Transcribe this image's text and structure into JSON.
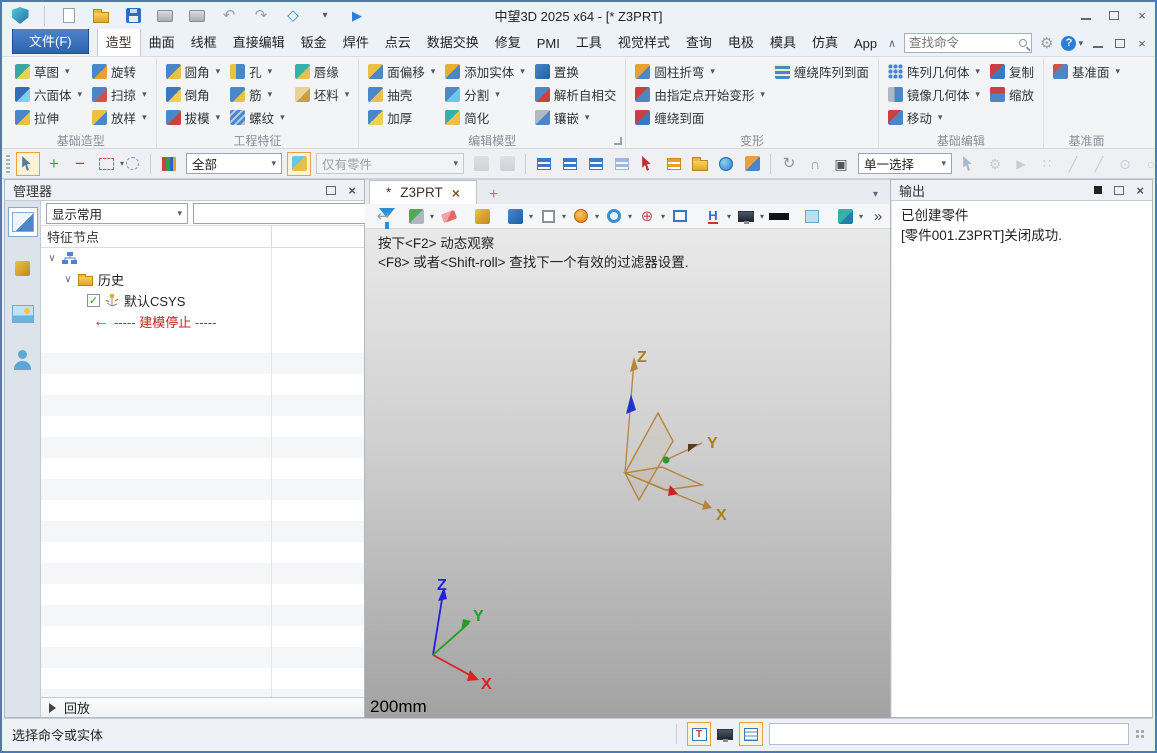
{
  "window": {
    "title": "中望3D 2025 x64 - [*  Z3PRT]"
  },
  "qat": {
    "icons": [
      {
        "icon": "app-logo-icon"
      },
      {
        "sep": true
      },
      {
        "icon": "new-file-icon"
      },
      {
        "icon": "open-file-icon"
      },
      {
        "icon": "save-icon"
      },
      {
        "icon": "print-icon"
      },
      {
        "icon": "plot-icon"
      },
      {
        "icon": "undo-icon"
      },
      {
        "icon": "redo-icon"
      },
      {
        "icon": "regen-icon"
      },
      {
        "icon": "qat-more-icon"
      },
      {
        "icon": "start-icon"
      }
    ]
  },
  "menu": {
    "file_button": "文件(F)",
    "tabs": [
      {
        "label": "造型",
        "active": true
      },
      {
        "label": "曲面"
      },
      {
        "label": "线框"
      },
      {
        "label": "直接编辑"
      },
      {
        "label": "钣金"
      },
      {
        "label": "焊件"
      },
      {
        "label": "点云"
      },
      {
        "label": "数据交换"
      },
      {
        "label": "修复"
      },
      {
        "label": "PMI"
      },
      {
        "label": "工具"
      },
      {
        "label": "视觉样式"
      },
      {
        "label": "查询"
      },
      {
        "label": "电极"
      },
      {
        "label": "模具"
      },
      {
        "label": "仿真"
      },
      {
        "label": "App"
      }
    ],
    "search_placeholder": "查找命令"
  },
  "ribbon": {
    "groups": [
      {
        "label": "基础造型",
        "items": [
          {
            "label": "草图",
            "icon": "sketch-icon",
            "dd": true
          },
          {
            "label": "六面体",
            "icon": "box-icon",
            "dd": true
          },
          {
            "label": "拉伸",
            "icon": "extrude-icon"
          },
          {
            "label": "旋转",
            "icon": "revolve-icon"
          },
          {
            "label": "扫掠",
            "icon": "sweep-icon",
            "dd": true
          },
          {
            "label": "放样",
            "icon": "loft-icon",
            "dd": true
          }
        ]
      },
      {
        "label": "工程特征",
        "items": [
          {
            "label": "圆角",
            "icon": "fillet-icon",
            "dd": true
          },
          {
            "label": "倒角",
            "icon": "chamfer-icon"
          },
          {
            "label": "拔模",
            "icon": "draft-icon",
            "dd": true
          },
          {
            "label": "孔",
            "icon": "hole-icon",
            "dd": true
          },
          {
            "label": "筋",
            "icon": "rib-icon",
            "dd": true
          },
          {
            "label": "螺纹",
            "icon": "thread-icon",
            "dd": true
          },
          {
            "label": "唇缘",
            "icon": "lip-icon"
          },
          {
            "label": "坯料",
            "icon": "stock-icon",
            "dd": true
          }
        ]
      },
      {
        "label": "编辑模型",
        "items": [
          {
            "label": "面偏移",
            "icon": "face-offset-icon",
            "dd": true
          },
          {
            "label": "抽壳",
            "icon": "shell-icon"
          },
          {
            "label": "加厚",
            "icon": "thicken-icon"
          },
          {
            "label": "添加实体",
            "icon": "add-shape-icon",
            "dd": true
          },
          {
            "label": "分割",
            "icon": "divide-icon",
            "dd": true
          },
          {
            "label": "简化",
            "icon": "simplify-icon"
          },
          {
            "label": "置换",
            "icon": "replace-icon"
          },
          {
            "label": "解析自相交",
            "icon": "self-intersection-icon"
          },
          {
            "label": "镶嵌",
            "icon": "emboss-icon",
            "dd": true
          }
        ]
      },
      {
        "label": "变形",
        "items": [
          {
            "label": "圆柱折弯",
            "icon": "cylindrical-bend-icon",
            "dd": true
          },
          {
            "label": "由指定点开始变形",
            "icon": "deform-by-point-icon",
            "dd": true
          },
          {
            "label": "缠绕到面",
            "icon": "wrap-to-face-icon"
          },
          {
            "label": "缠绕阵列到面",
            "icon": "wrap-pattern-icon"
          }
        ]
      },
      {
        "label": "基础编辑",
        "items": [
          {
            "label": "阵列几何体",
            "icon": "pattern-geometry-icon",
            "dd": true
          },
          {
            "label": "镜像几何体",
            "icon": "mirror-geometry-icon",
            "dd": true
          },
          {
            "label": "移动",
            "icon": "move-icon",
            "dd": true
          },
          {
            "label": "复制",
            "icon": "copy-icon"
          },
          {
            "label": "缩放",
            "icon": "scale-icon"
          }
        ]
      },
      {
        "label": "基准面",
        "items": [
          {
            "label": "基准面",
            "icon": "datum-plane-icon",
            "dd": true
          }
        ]
      }
    ]
  },
  "selection_toolbar": {
    "groupA": [
      {
        "icon": "pick-cursor-icon",
        "hl": true
      },
      {
        "icon": "add-entity-icon"
      },
      {
        "icon": "remove-entity-icon"
      },
      {
        "icon": "window-select-icon",
        "dd": true
      },
      {
        "icon": "lasso-select-icon"
      },
      {
        "sep": true
      },
      {
        "icon": "filter-list-icon"
      }
    ],
    "filter_all": "全部",
    "groupB": [
      {
        "icon": "shape-filter-icon",
        "hl": true
      }
    ],
    "entity_filter": "仅有零件",
    "groupC": [
      {
        "icon": "constraint-icon",
        "dim": true
      },
      {
        "icon": "fix-icon",
        "dim": true
      },
      {
        "sep": true
      },
      {
        "icon": "show-target-icon"
      },
      {
        "icon": "show-all-icon"
      },
      {
        "icon": "hide-target-icon"
      },
      {
        "icon": "blank-icon",
        "dim": true
      },
      {
        "icon": "pick-from-list-icon"
      },
      {
        "icon": "list-manager-icon"
      },
      {
        "icon": "open-folder-icon"
      },
      {
        "icon": "reuse-library-icon"
      },
      {
        "icon": "plugin-icon"
      },
      {
        "sep": true
      },
      {
        "icon": "orbit-icon"
      },
      {
        "icon": "curve-tool-icon"
      },
      {
        "icon": "window-mode-icon"
      }
    ],
    "pick_mode": "单一选择",
    "groupD": [
      {
        "icon": "pointer-dim-icon",
        "dim": true
      },
      {
        "icon": "gear-small-icon",
        "dim": true
      },
      {
        "icon": "play-circle-icon",
        "dim": true
      },
      {
        "icon": "point-cloud-icon",
        "dim": true
      },
      {
        "icon": "line-tool-icon",
        "dim": true
      },
      {
        "icon": "polyline-tool-icon",
        "dim": true
      },
      {
        "icon": "circle-point-icon",
        "dim": true
      },
      {
        "icon": "circle-tool-icon",
        "dim": true
      },
      {
        "icon": "spline-tool-icon",
        "dim": true
      },
      {
        "icon": "curve2-tool-icon",
        "dim": true
      },
      {
        "icon": "toolbar-overflow-icon"
      }
    ]
  },
  "manager": {
    "title": "管理器",
    "side_icons": [
      {
        "icon": "history-manager-icon",
        "active": true
      },
      {
        "icon": "solid-manager-icon"
      },
      {
        "icon": "visual-manager-icon"
      },
      {
        "icon": "role-manager-icon"
      }
    ],
    "combo_value": "显示常用",
    "tree_header": "特征节点",
    "history_label": "历史",
    "csys_label": "默认CSYS",
    "stop_label": "----- 建模停止 -----",
    "playback_label": "回放"
  },
  "document": {
    "tab_modified": "*",
    "tab_label": "Z3PRT"
  },
  "viewport": {
    "toolbar": [
      {
        "icon": "exit-icon"
      },
      {
        "icon": "show-hide-icon",
        "dd": true
      },
      {
        "icon": "erase-icon"
      },
      {
        "icon": "csys-display-icon"
      },
      {
        "icon": "shaded-display-icon",
        "dd": true
      },
      {
        "icon": "wireframe-display-icon",
        "dd": true
      },
      {
        "icon": "render-mode-icon",
        "dd": true
      },
      {
        "icon": "zoom-icon",
        "dd": true
      },
      {
        "icon": "rotate-view-icon",
        "dd": true
      },
      {
        "icon": "fit-window-icon"
      },
      {
        "icon": "measure-icon",
        "dd": true
      },
      {
        "icon": "monitor-icon",
        "dd": true
      },
      {
        "icon": "line-width-icon"
      },
      {
        "icon": "bg-color-icon"
      },
      {
        "icon": "layer-icon",
        "dd": true
      },
      {
        "icon": "viewport-overflow-icon"
      }
    ],
    "hint_line1": "按下<F2> 动态观察",
    "hint_line2": "<F8> 或者<Shift-roll> 查找下一个有效的过滤器设置.",
    "scale_label": "200mm",
    "axes": {
      "x": "X",
      "y": "Y",
      "z": "Z"
    }
  },
  "output": {
    "title": "输出",
    "lines": [
      "已创建零件",
      "[零件001.Z3PRT]关闭成功."
    ]
  },
  "status": {
    "message": "选择命令或实体",
    "icons": [
      {
        "icon": "toolbox-icon",
        "hl": true
      },
      {
        "icon": "monitor-status-icon"
      },
      {
        "icon": "notes-icon",
        "hl": true
      }
    ]
  }
}
